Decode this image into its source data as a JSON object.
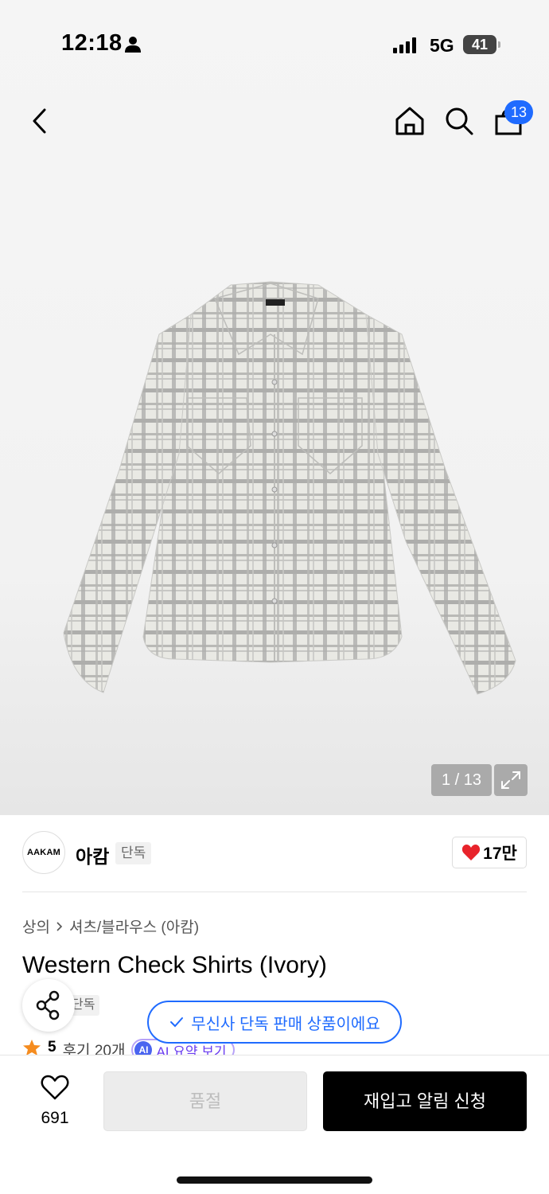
{
  "status_bar": {
    "time": "12:18",
    "network": "5G",
    "battery": "41"
  },
  "nav": {
    "cart_count": "13"
  },
  "gallery": {
    "counter": "1 / 13"
  },
  "brand": {
    "logo_text": "AAKAM",
    "name": "아캄",
    "tag": "단독",
    "likes": "17만"
  },
  "breadcrumb": {
    "category": "상의",
    "subcategory": "셔츠/블라우스 (아캄)"
  },
  "product": {
    "title": "Western Check Shirts (Ivory)",
    "exclusive_badge": "단독"
  },
  "toast": {
    "message": "무신사 단독 판매 상품이에요"
  },
  "rating": {
    "score": "5",
    "reviews": "후기 20개",
    "ai_label": "AI 요약 보기",
    "ai_badge": "AI"
  },
  "bottom": {
    "wish_count": "691",
    "soldout_label": "품절",
    "restock_label": "재입고 알림 신청"
  },
  "colors": {
    "accent": "#1f6bff",
    "like_heart": "#e8232b",
    "ai_purple": "#6a3df0"
  },
  "icons": [
    "person-icon",
    "signal-icon",
    "battery-icon",
    "back-arrow-icon",
    "home-icon",
    "search-icon",
    "cart-icon",
    "expand-icon",
    "heart-icon",
    "chevron-right-icon",
    "share-icon",
    "check-icon",
    "star-icon"
  ]
}
